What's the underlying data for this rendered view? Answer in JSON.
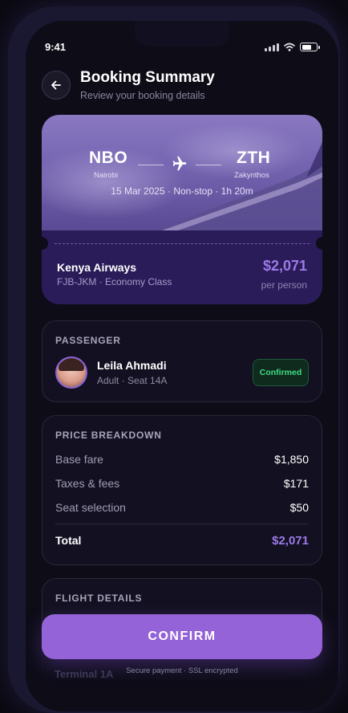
{
  "status_bar": {
    "time": "9:41"
  },
  "header": {
    "title": "Booking Summary",
    "subtitle": "Review your booking details"
  },
  "flight": {
    "origin_code": "NBO",
    "origin_city": "Nairobi",
    "destination_code": "ZTH",
    "destination_city": "Zakynthos",
    "details": "15 Mar 2025 · Non-stop · 1h 20m",
    "airline": "Kenya Airways",
    "route_class": "FJB-JKM · Economy Class",
    "price": "$2,071",
    "price_note": "per person"
  },
  "passenger": {
    "section_title": "PASSENGER",
    "name": "Leila Ahmadi",
    "meta": "Adult · Seat 14A",
    "status": "Confirmed"
  },
  "price_breakdown": {
    "section_title": "PRICE BREAKDOWN",
    "rows": [
      {
        "label": "Base fare",
        "value": "$1,850"
      },
      {
        "label": "Taxes & fees",
        "value": "$171"
      },
      {
        "label": "Seat selection",
        "value": "$50"
      }
    ],
    "total_label": "Total",
    "total_value": "$2,071"
  },
  "flight_details": {
    "section_title": "FLIGHT DETAILS",
    "partial_text": "Terminal 1A"
  },
  "footer": {
    "confirm_label": "CONFIRM",
    "secure_note": "Secure payment · SSL encrypted"
  },
  "colors": {
    "accent": "#9563d8",
    "price_text": "#9d7ae8",
    "success": "#3fdc84",
    "background": "#0d0c17"
  }
}
